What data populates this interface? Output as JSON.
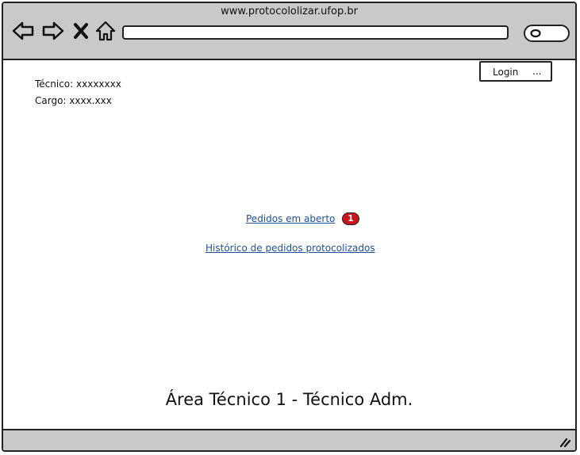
{
  "browser": {
    "site_title": "www.protocololizar.ufop.br",
    "address_value": "",
    "icons": [
      "back-icon",
      "forward-icon",
      "close-icon",
      "home-icon",
      "search-icon",
      "resize-icon"
    ]
  },
  "user": {
    "tecnico_line": "Técnico: xxxxxxxx",
    "cargo_line": "Cargo: xxxx.xxx"
  },
  "login": {
    "label": "Login",
    "dots": "..."
  },
  "main": {
    "open_requests_link": "Pedidos em aberto",
    "open_requests_count": "1",
    "history_link": "Histórico de pedidos protocolizados",
    "area_title": "Área Técnico 1 - Técnico Adm."
  },
  "colors": {
    "chrome": "#c9c9c9",
    "link": "#1f4f9a",
    "badge": "#c8141a"
  }
}
